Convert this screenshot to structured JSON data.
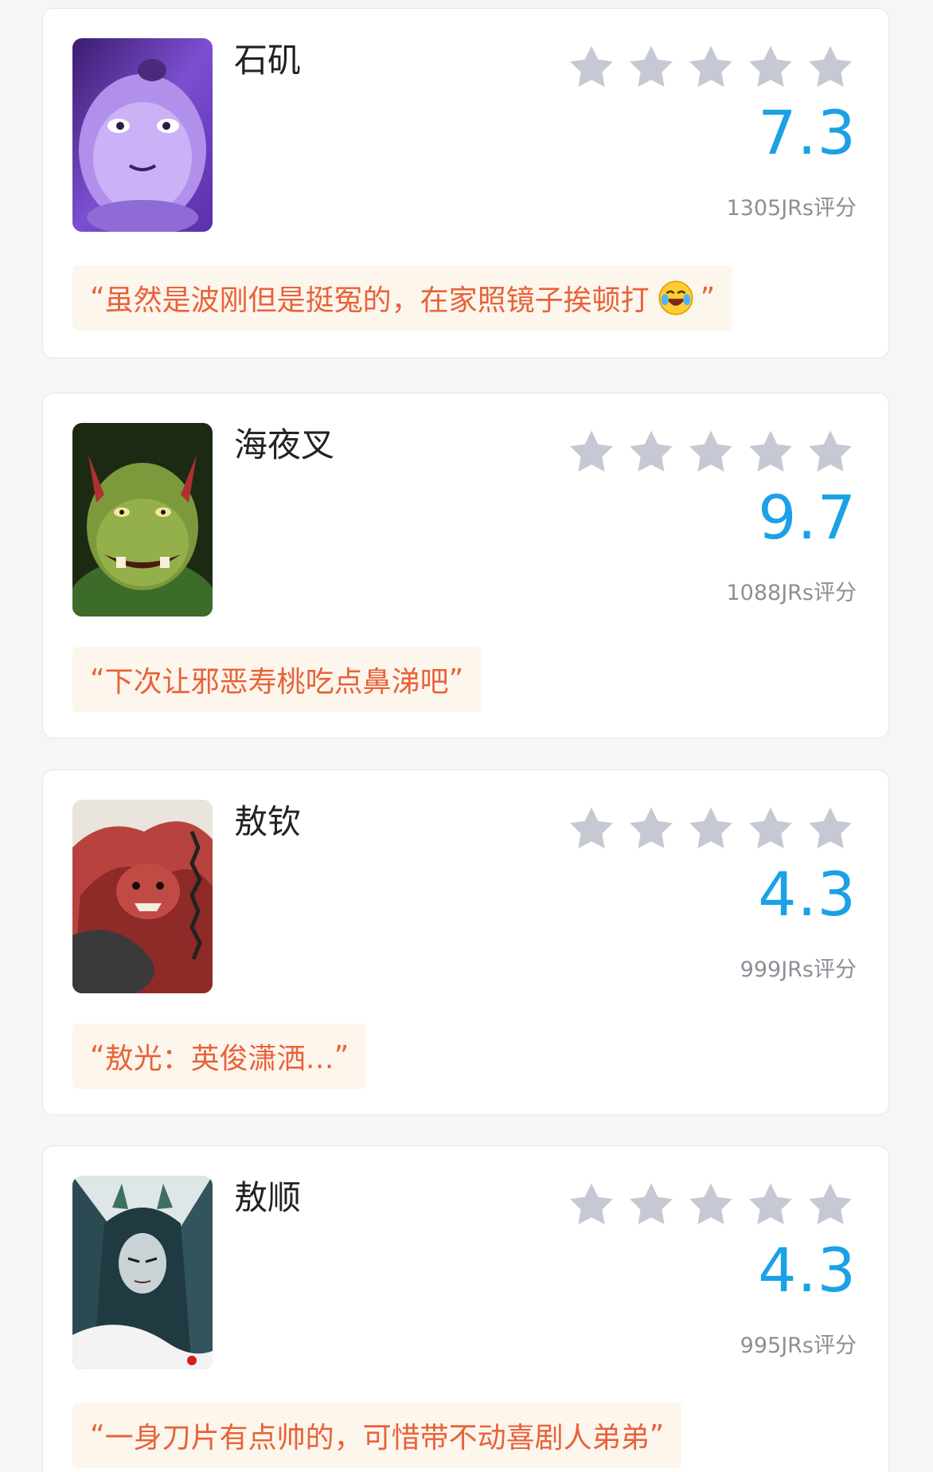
{
  "cards": [
    {
      "name": "石矶",
      "score": "7.3",
      "count": "1305JRs评分",
      "quote_open": "“",
      "comment": "虽然是波刚但是挺冤的，在家照镜子挨顿打",
      "emoji": "laughing-tears-emoji",
      "quote_close": "”",
      "avatar": "shiji-avatar",
      "stars_total": 5,
      "stars_filled": 0
    },
    {
      "name": "海夜叉",
      "score": "9.7",
      "count": "1088JRs评分",
      "quote_open": "“",
      "comment": "下次让邪恶寿桃吃点鼻涕吧",
      "quote_close": "”",
      "avatar": "haiyecha-avatar",
      "stars_total": 5,
      "stars_filled": 0
    },
    {
      "name": "敖钦",
      "score": "4.3",
      "count": "999JRs评分",
      "quote_open": "“",
      "comment": "敖光：英俊潇洒…",
      "quote_close": "”",
      "avatar": "aoqin-avatar",
      "stars_total": 5,
      "stars_filled": 0
    },
    {
      "name": "敖顺",
      "score": "4.3",
      "count": "995JRs评分",
      "quote_open": "“",
      "comment": "一身刀片有点帅的，可惜带不动喜剧人弟弟",
      "quote_close": "”",
      "avatar": "aoshun-avatar",
      "stars_total": 5,
      "stars_filled": 0
    }
  ],
  "colors": {
    "score": "#1aa1e6",
    "quote_text": "#e8623a",
    "quote_bg": "#fdf6ec",
    "star_empty": "#c6c8d3"
  },
  "icons": {
    "star": "star-icon"
  }
}
